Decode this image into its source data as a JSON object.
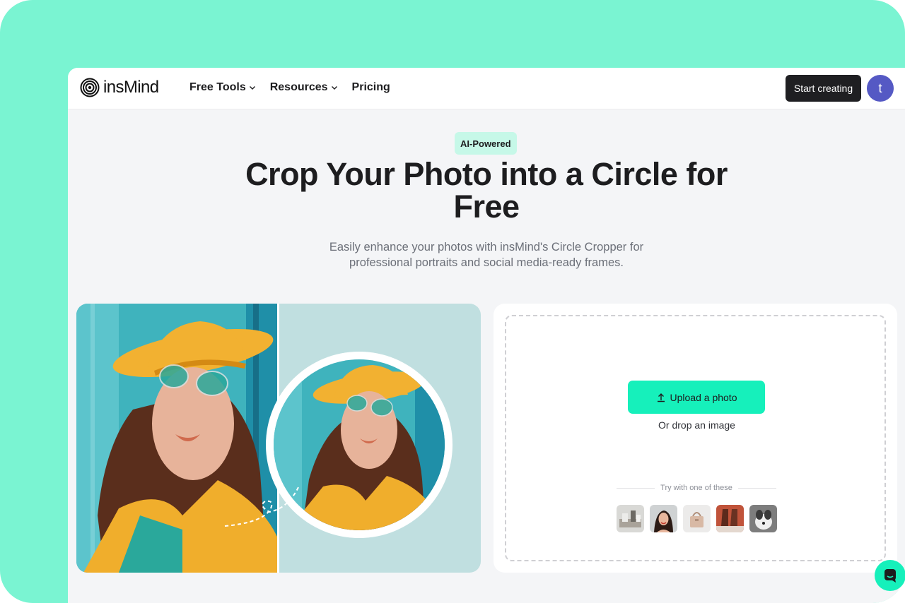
{
  "nav": {
    "logo_text": "insMind",
    "menu": [
      {
        "label": "Free Tools",
        "has_dropdown": true
      },
      {
        "label": "Resources",
        "has_dropdown": true
      },
      {
        "label": "Pricing",
        "has_dropdown": false
      }
    ],
    "start_button": "Start creating",
    "avatar_letter": "t"
  },
  "hero": {
    "badge": "AI-Powered",
    "title": "Crop Your Photo into a Circle for Free",
    "subtitle_line1": "Easily enhance your photos with insMind's Circle Cropper for",
    "subtitle_line2": "professional portraits and social media-ready frames."
  },
  "upload": {
    "button_label": "Upload a photo",
    "drop_text": "Or drop an image",
    "try_text": "Try with one of these",
    "samples": [
      "sample-products",
      "sample-woman-portrait",
      "sample-handbag",
      "sample-boots",
      "sample-dog"
    ]
  },
  "colors": {
    "brand_mint": "#16f0bb",
    "frame_background": "#7af4d2",
    "badge_background": "#c6f8e8",
    "avatar": "#5559c4"
  },
  "icons": {
    "upload": "upload-arrow-icon",
    "chat": "chat-bubble-icon",
    "chevron": "chevron-down-icon"
  }
}
